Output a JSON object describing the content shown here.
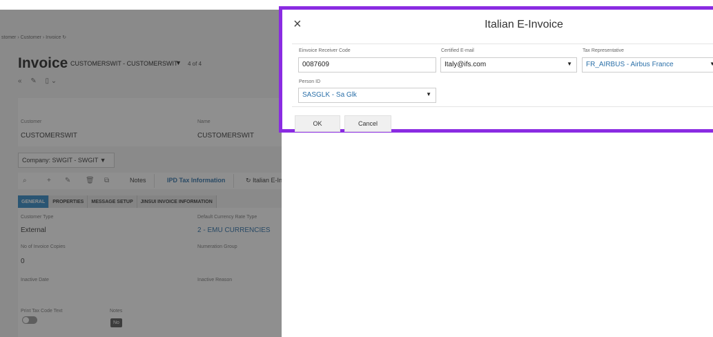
{
  "background": {
    "breadcrumb": "stomer  ›  Customer  ›  Invoice   ↻",
    "page_title": "Invoice",
    "record_name": "CUSTOMERSWIT - CUSTOMERSWIT",
    "record_count": "4 of 4",
    "title_icons": [
      "«",
      "✎",
      "▯ ⌄"
    ],
    "header": {
      "customer_label": "Customer",
      "customer_value": "CUSTOMERSWIT",
      "name_label": "Name",
      "name_value": "CUSTOMERSWIT"
    },
    "company_selector": "Company: SWGIT - SWGIT  ▼",
    "toolbar": {
      "icons": [
        "⌕",
        "+",
        "✎",
        "🗑",
        "⧉"
      ],
      "notes": "Notes",
      "ipd_tax": "IPD Tax Information",
      "italian": "↻ Italian E-In"
    },
    "tabs": [
      "GENERAL",
      "PROPERTIES",
      "MESSAGE SETUP",
      "JINSUI INVOICE INFORMATION"
    ],
    "fields": {
      "customer_type_label": "Customer Type",
      "customer_type_value": "External",
      "currency_rate_label": "Default Currency Rate Type",
      "currency_rate_value": "2 - EMU CURRENCIES",
      "copies_label": "No of Invoice Copies",
      "copies_value": "0",
      "numeration_label": "Numeration Group",
      "inactive_date_label": "Inactive Date",
      "inactive_reason_label": "Inactive Reason",
      "print_tax_label": "Print Tax Code Text",
      "notes_label": "Notes",
      "notes_value": "No"
    }
  },
  "modal": {
    "title": "Italian E-Invoice",
    "close_icon": "×",
    "fields": {
      "receiver_code_label": "Einvoice Receiver Code",
      "receiver_code_value": "0087609",
      "email_label": "Certified E-mail",
      "email_value": "Italy@ifs.com",
      "tax_rep_label": "Tax Representative",
      "tax_rep_value": "FR_AIRBUS - Airbus France",
      "person_label": "Person ID",
      "person_value": "SASGLK - Sa Glk"
    },
    "ok_label": "OK",
    "cancel_label": "Cancel",
    "accent_color": "#8a2be2",
    "link_color": "#2a6fa8"
  }
}
